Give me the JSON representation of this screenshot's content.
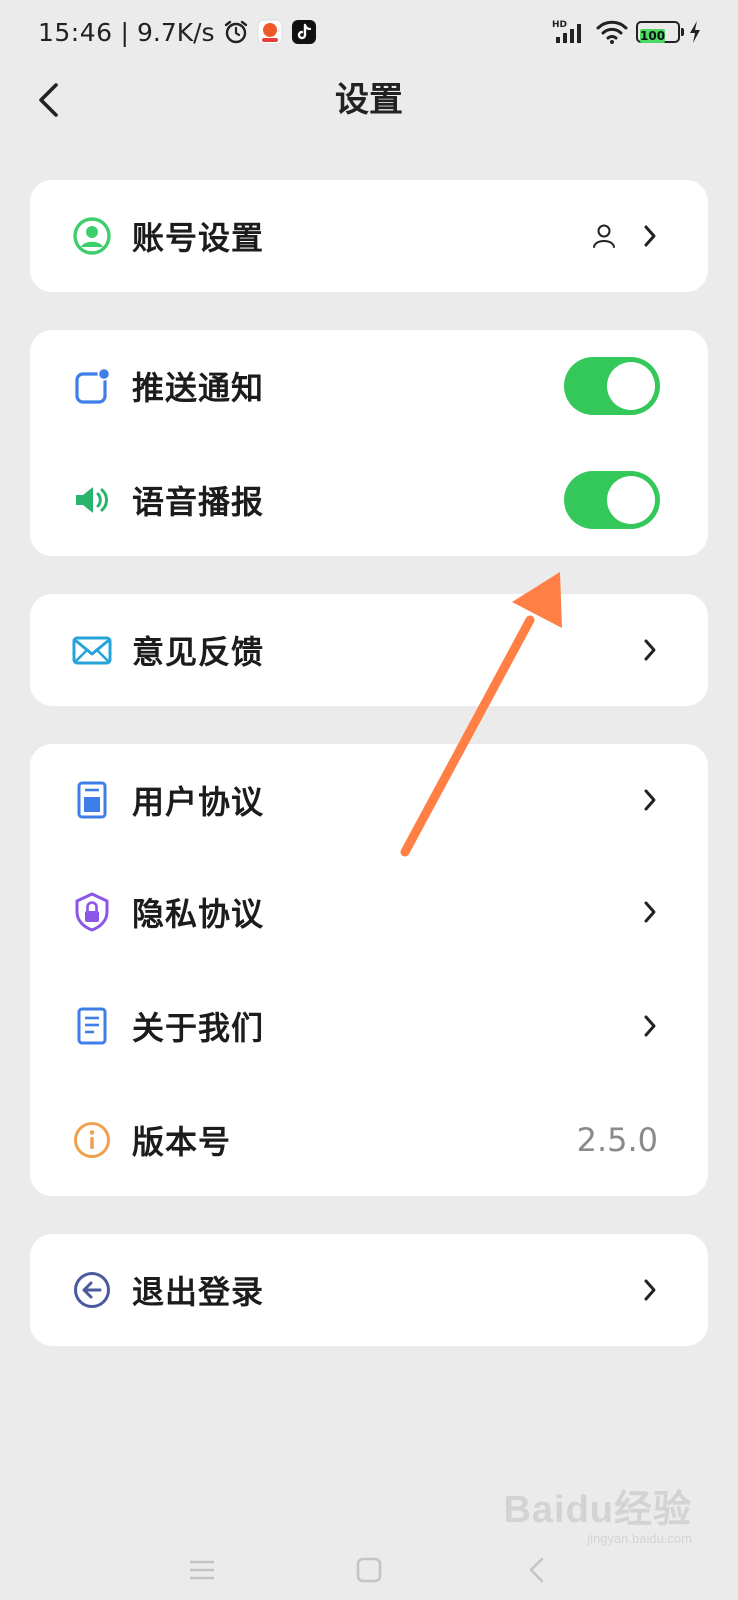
{
  "status_bar": {
    "time": "15:46",
    "separator": "|",
    "net_speed": "9.7K/s",
    "network_type": "HD",
    "battery": "100"
  },
  "header": {
    "title": "设置"
  },
  "sections": {
    "account": {
      "label": "账号设置"
    },
    "push": {
      "label": "推送通知",
      "enabled": true
    },
    "voice": {
      "label": "语音播报",
      "enabled": true
    },
    "feedback": {
      "label": "意见反馈"
    },
    "user_agreement": {
      "label": "用户协议"
    },
    "privacy": {
      "label": "隐私协议"
    },
    "about": {
      "label": "关于我们"
    },
    "version": {
      "label": "版本号",
      "value": "2.5.0"
    },
    "logout": {
      "label": "退出登录"
    }
  },
  "colors": {
    "background": "#ebebeb",
    "card": "#ffffff",
    "toggle_on": "#34c759",
    "account_icon": "#3ccf6b",
    "push_icon": "#3d7ee8",
    "voice_icon": "#27b56d",
    "feedback_icon": "#27a3d9",
    "doc_icon": "#3d7ee8",
    "privacy_icon": "#8c56e8",
    "version_icon": "#f0a050",
    "logout_icon": "#4a5a9e",
    "annotation_arrow": "#ff7f45"
  },
  "watermark": {
    "main": "Baidu经验",
    "sub": "jingyan.baidu.com"
  }
}
